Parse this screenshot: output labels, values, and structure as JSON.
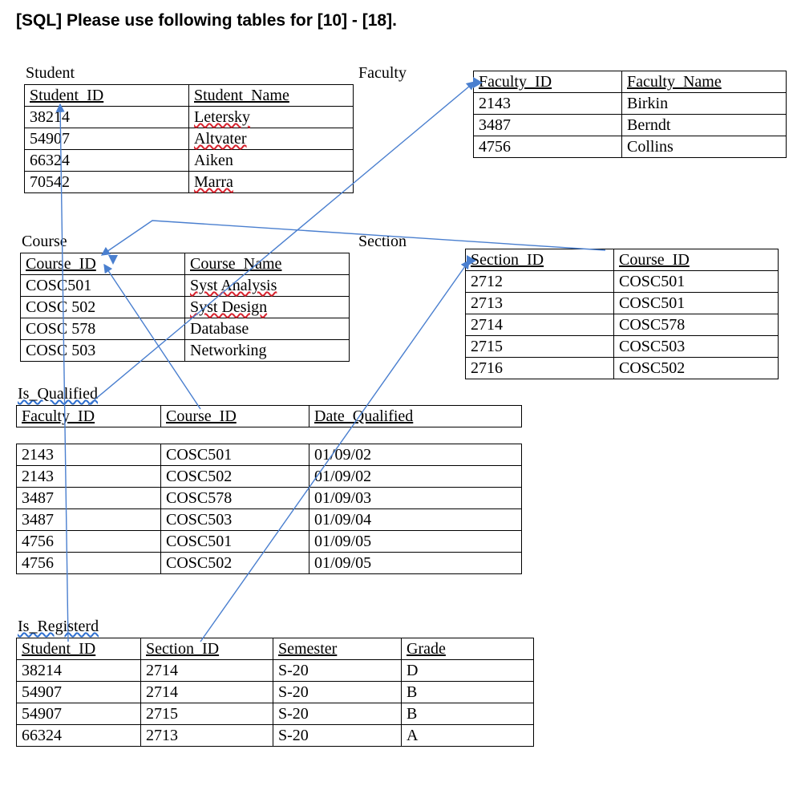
{
  "page": {
    "title": "[SQL] Please use following tables for [10] - [18]."
  },
  "tables": {
    "student": {
      "label": "Student",
      "headers": [
        "Student_ID",
        "Student_Name"
      ],
      "rows": [
        [
          "38214",
          "Letersky"
        ],
        [
          "54907",
          "Altvater"
        ],
        [
          "66324",
          "Aiken"
        ],
        [
          "70542",
          "Marra"
        ]
      ]
    },
    "faculty": {
      "label": "Faculty",
      "headers": [
        "Faculty_ID",
        "Faculty_Name"
      ],
      "rows": [
        [
          "2143",
          "Birkin"
        ],
        [
          "3487",
          "Berndt"
        ],
        [
          "4756",
          "Collins"
        ]
      ]
    },
    "course": {
      "label": "Course",
      "headers": [
        "Course_ID",
        "Course_Name"
      ],
      "rows": [
        [
          "COSC501",
          "Syst Analysis"
        ],
        [
          "COSC 502",
          "Syst Design"
        ],
        [
          "COSC 578",
          "Database"
        ],
        [
          "COSC 503",
          "Networking"
        ]
      ]
    },
    "section": {
      "label": "Section",
      "headers": [
        "Section_ID",
        "Course_ID"
      ],
      "rows": [
        [
          "2712",
          "COSC501"
        ],
        [
          "2713",
          "COSC501"
        ],
        [
          "2714",
          "COSC578"
        ],
        [
          "2715",
          "COSC503"
        ],
        [
          "2716",
          "COSC502"
        ]
      ]
    },
    "is_qualified": {
      "label": "Is_Qualified",
      "headers": [
        "Faculty_ID",
        "Course_ID",
        "Date_Qualified"
      ],
      "rows": [
        [
          "2143",
          "COSC501",
          "01/09/02"
        ],
        [
          "2143",
          "COSC502",
          "01/09/02"
        ],
        [
          "3487",
          "COSC578",
          "01/09/03"
        ],
        [
          "3487",
          "COSC503",
          "01/09/04"
        ],
        [
          "4756",
          "COSC501",
          "01/09/05"
        ],
        [
          "4756",
          "COSC502",
          "01/09/05"
        ]
      ]
    },
    "is_registered": {
      "label": "Is_Registerd",
      "headers": [
        "Student_ID",
        "Section_ID",
        "Semester",
        "Grade"
      ],
      "rows": [
        [
          "38214",
          "2714",
          "S-20",
          "D"
        ],
        [
          "54907",
          "2714",
          "S-20",
          "B"
        ],
        [
          "54907",
          "2715",
          "S-20",
          "B"
        ],
        [
          "66324",
          "2713",
          "S-20",
          "A"
        ]
      ]
    }
  },
  "chart_data": {
    "type": "table",
    "title": "Relational schema used for SQL questions 10-18",
    "relations": [
      {
        "name": "Student",
        "pk": "Student_ID"
      },
      {
        "name": "Faculty",
        "pk": "Faculty_ID"
      },
      {
        "name": "Course",
        "pk": "Course_ID"
      },
      {
        "name": "Section",
        "pk": "Section_ID",
        "fk": [
          {
            "col": "Course_ID",
            "ref": "Course.Course_ID"
          }
        ]
      },
      {
        "name": "Is_Qualified",
        "fk": [
          {
            "col": "Faculty_ID",
            "ref": "Faculty.Faculty_ID"
          },
          {
            "col": "Course_ID",
            "ref": "Course.Course_ID"
          }
        ]
      },
      {
        "name": "Is_Registerd",
        "fk": [
          {
            "col": "Student_ID",
            "ref": "Student.Student_ID"
          },
          {
            "col": "Section_ID",
            "ref": "Section.Section_ID"
          }
        ]
      }
    ]
  }
}
